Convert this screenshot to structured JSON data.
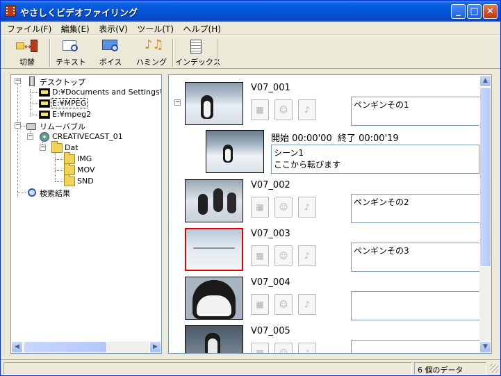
{
  "window": {
    "title": "やさしくビデオファイリング",
    "minimize": "_",
    "maximize": "□",
    "close": "✕"
  },
  "menu": [
    "ファイル(F)",
    "編集(E)",
    "表示(V)",
    "ツール(T)",
    "ヘルプ(H)"
  ],
  "toolbar": {
    "switch": "切替",
    "text": "テキスト",
    "voice": "ボイス",
    "humming": "ハミング",
    "index": "インデックス"
  },
  "tree": {
    "desktop": "デスクトップ",
    "doc": "D:¥Documents and Settings¥ta",
    "empeg": "E:¥MPEG",
    "empeg2": "E:¥mpeg2",
    "removable": "リムーバブル",
    "creative": "CREATIVECAST_01",
    "dat": "Dat",
    "img": "IMG",
    "mov": "MOV",
    "snd": "SND",
    "search": "検索結果"
  },
  "videos": [
    {
      "name": "V07_001",
      "memo": "ペンギンその1"
    },
    {
      "name": "V07_002",
      "memo": "ペンギンその2"
    },
    {
      "name": "V07_003",
      "memo": "ペンギンその3"
    },
    {
      "name": "V07_004",
      "memo": ""
    },
    {
      "name": "V07_005",
      "memo": ""
    }
  ],
  "scene": {
    "time": "開始 00:00'00  終了 00:00'19",
    "memo": "シーン1\nここから転びます"
  },
  "icons": {
    "film": "film-icon",
    "voice": "voice-icon",
    "music": "music-icon"
  },
  "status": {
    "count": "6 個のデータ"
  },
  "colors": {
    "titlebar": "#0451d6",
    "selected_border": "#e00000",
    "panel_border": "#7f9db9"
  }
}
